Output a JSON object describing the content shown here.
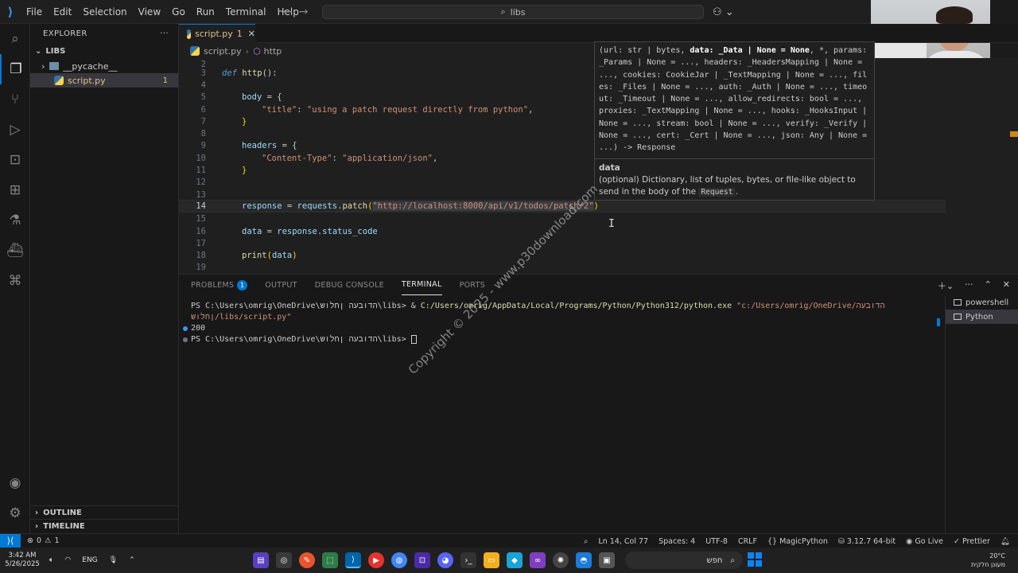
{
  "titlebar": {
    "menu": [
      "File",
      "Edit",
      "Selection",
      "View",
      "Go",
      "Run",
      "Terminal",
      "Help"
    ],
    "search": "libs",
    "back_icon": "arrow-left-icon",
    "forward_icon": "arrow-right-icon"
  },
  "sidebar": {
    "title": "EXPLORER",
    "more": "···",
    "folder": "LIBS",
    "items": [
      {
        "label": "__pycache__",
        "type": "folder"
      },
      {
        "label": "script.py",
        "type": "python",
        "badge": "1"
      }
    ],
    "outline": "OUTLINE",
    "timeline": "TIMELINE"
  },
  "tab": {
    "label": "script.py",
    "badge": "1",
    "close": "✕"
  },
  "breadcrumb": {
    "file": "script.py",
    "symbol": "http",
    "sep": "›"
  },
  "editor": {
    "line_numbers": [
      "2",
      "3",
      "4",
      "5",
      "6",
      "7",
      "8",
      "9",
      "10",
      "11",
      "12",
      "13",
      "14",
      "15",
      "16",
      "17",
      "18",
      "19"
    ],
    "current_line": "14",
    "lines": {
      "l3_kw": "def",
      "l3_fn": "http",
      "l3_rest": "():",
      "l5_var": "body",
      "l5_rest": " = {",
      "l6_key": "\"title\"",
      "l6_val": "\"using a patch request directly from python\"",
      "l7": "}",
      "l9_var": "headers",
      "l9_rest": " = {",
      "l10_key": "\"Content-Type\"",
      "l10_val": "\"application/json\"",
      "l11": "}",
      "l14_var": "response",
      "l14_mod": "requests",
      "l14_method": "patch",
      "l14_url": "\"http://localhost:8000/api/v1/todos/patch/2\"",
      "l16_var": "data",
      "l16_obj": "response",
      "l16_attr": "status_code",
      "l18_fn": "print",
      "l18_arg": "data"
    }
  },
  "hover": {
    "signature_pre": "(url: str | bytes, ",
    "signature_bold": "data: _Data | None = None",
    "signature_post": ", *, params: _Params | None = ..., headers: _HeadersMapping | None = ..., cookies: CookieJar | _TextMapping | None = ..., files: _Files | None = ..., auth: _Auth | None = ..., timeout: _Timeout | None = ..., allow_redirects: bool = ..., proxies: _TextMapping | None = ..., hooks: _HooksInput | None = ..., stream: bool | None = ..., verify: _Verify | None = ..., cert: _Cert | None = ..., json: Any | None = ...) -> Response",
    "doc_title": "data",
    "doc_text": "(optional) Dictionary, list of tuples, bytes, or file-like object to send in the body of the",
    "doc_code": "Request",
    "doc_end": "."
  },
  "panel": {
    "tabs": [
      {
        "label": "PROBLEMS",
        "badge": "1"
      },
      {
        "label": "OUTPUT"
      },
      {
        "label": "DEBUG CONSOLE"
      },
      {
        "label": "TERMINAL",
        "active": true
      },
      {
        "label": "PORTS"
      }
    ],
    "terminal": {
      "prompt1": "PS C:\\Users\\omrig\\OneDrive\\הדובעה ןחלוש\\libs>",
      "amp": " & ",
      "exe": "C:/Users/omrig/AppData/Local/Programs/Python/Python312/python.exe",
      "script_path": " \"c:/Users/omrig/OneDrive/הדובעה ןחלוש/libs/script.py\"",
      "output": "200",
      "prompt2": "PS C:\\Users\\omrig\\OneDrive\\הדובעה ןחלוש\\libs>"
    },
    "terminal_list": [
      "powershell",
      "Python"
    ]
  },
  "statusbar": {
    "errors": "0",
    "warnings": "1",
    "position": "Ln 14, Col 77",
    "spaces": "Spaces: 4",
    "encoding": "UTF-8",
    "eol": "CRLF",
    "language": "MagicPython",
    "interpreter": "3.12.7 64-bit",
    "golive": "Go Live",
    "prettier": "Prettier"
  },
  "taskbar": {
    "time": "3:42 AM",
    "date": "5/26/2025",
    "lang": "ENG",
    "search_placeholder": "חפש",
    "weather": "20°C",
    "weather_desc": "מעונן חלקית"
  },
  "watermark": "Copyright © 2025 - www.p30download.com",
  "colors": {
    "accent": "#0078d4",
    "editor_bg": "#1f1f1f",
    "sidebar_bg": "#181818"
  }
}
